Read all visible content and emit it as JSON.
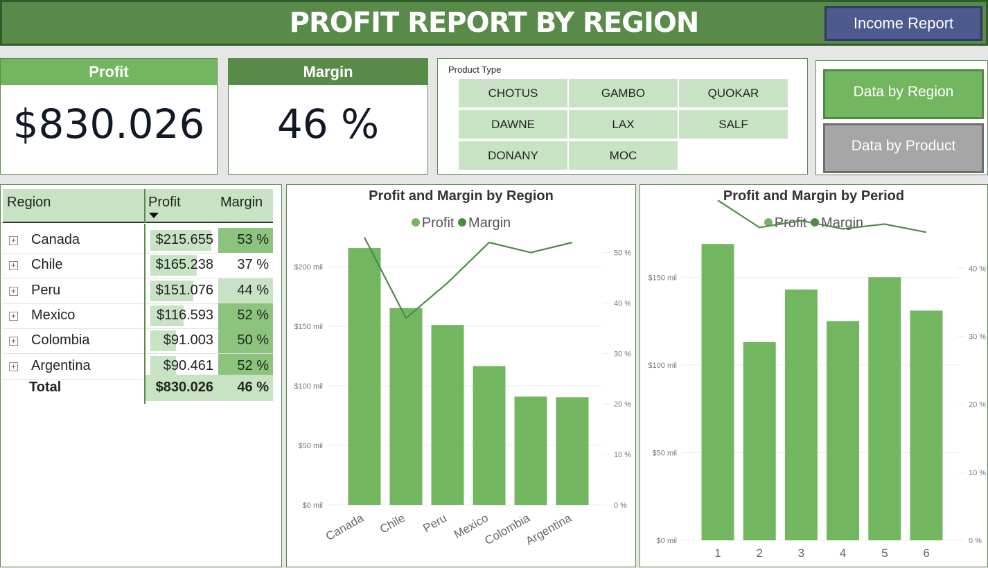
{
  "header": {
    "title": "PROFIT REPORT BY REGION",
    "income_button": "Income Report"
  },
  "colors": {
    "header_green": "#5a8a4a",
    "bar_green": "#73b660",
    "line_green": "#4f8a45",
    "light_green": "#c8e2c4",
    "dark_green": "#5a8a4a",
    "button_blue": "#4d5a8e",
    "button_gray": "#a6a6a6"
  },
  "cards": {
    "profit": {
      "label": "Profit",
      "value": "$830.026"
    },
    "margin": {
      "label": "Margin",
      "value": "46 %"
    }
  },
  "slicer": {
    "title": "Product Type",
    "options": [
      "CHOTUS",
      "GAMBO",
      "QUOKAR",
      "DAWNE",
      "LAX",
      "SALF",
      "DONANY",
      "MOC"
    ]
  },
  "nav": {
    "by_region": "Data by Region",
    "by_product": "Data by Product"
  },
  "table": {
    "headers": {
      "region": "Region",
      "profit": "Profit",
      "margin": "Margin"
    },
    "rows": [
      {
        "region": "Canada",
        "profit": "$215.655",
        "margin": "53 %",
        "profit_num": 215.655,
        "margin_num": 53
      },
      {
        "region": "Chile",
        "profit": "$165.238",
        "margin": "37 %",
        "profit_num": 165.238,
        "margin_num": 37
      },
      {
        "region": "Peru",
        "profit": "$151.076",
        "margin": "44 %",
        "profit_num": 151.076,
        "margin_num": 44
      },
      {
        "region": "Mexico",
        "profit": "$116.593",
        "margin": "52 %",
        "profit_num": 116.593,
        "margin_num": 52
      },
      {
        "region": "Colombia",
        "profit": "$91.003",
        "margin": "50 %",
        "profit_num": 91.003,
        "margin_num": 50
      },
      {
        "region": "Argentina",
        "profit": "$90.461",
        "margin": "52 %",
        "profit_num": 90.461,
        "margin_num": 52
      }
    ],
    "total": {
      "label": "Total",
      "profit": "$830.026",
      "margin": "46 %"
    }
  },
  "chart_data": [
    {
      "type": "bar",
      "title": "Profit and Margin by Region",
      "legend": [
        "Profit",
        "Margin"
      ],
      "legend_position": "top-center",
      "categories": [
        "Canada",
        "Chile",
        "Peru",
        "Mexico",
        "Colombia",
        "Argentina"
      ],
      "series": [
        {
          "name": "Profit",
          "type": "bar",
          "axis": "left",
          "values": [
            215.655,
            165.238,
            151.076,
            116.593,
            91.003,
            90.461
          ]
        },
        {
          "name": "Margin",
          "type": "line",
          "axis": "right",
          "values": [
            53,
            37,
            44,
            52,
            50,
            52
          ]
        }
      ],
      "y_left": {
        "ylim": [
          0,
          200
        ],
        "ticks": [
          0,
          50,
          100,
          150,
          200
        ],
        "tick_labels": [
          "$0 mil",
          "$50 mil",
          "$100 mil",
          "$150 mil",
          "$200 mil"
        ],
        "max": 250
      },
      "y_right": {
        "ylim": [
          0,
          50
        ],
        "ticks": [
          0,
          10,
          20,
          30,
          40,
          50
        ],
        "tick_labels": [
          "0 %",
          "10 %",
          "20 %",
          "30 %",
          "40 %",
          "50 %"
        ],
        "max": 59
      },
      "grid": true
    },
    {
      "type": "bar",
      "title": "Profit and Margin by Period",
      "legend": [
        "Profit",
        "Margin"
      ],
      "legend_position": "top-center",
      "categories": [
        "1",
        "2",
        "3",
        "4",
        "5",
        "6"
      ],
      "series": [
        {
          "name": "Profit",
          "type": "bar",
          "axis": "left",
          "values": [
            169,
            113,
            143,
            125,
            150,
            131
          ]
        },
        {
          "name": "Margin",
          "type": "line",
          "axis": "right",
          "values": [
            50,
            46,
            47,
            45.8,
            46.5,
            45.3
          ]
        }
      ],
      "y_left": {
        "ylim": [
          0,
          150
        ],
        "ticks": [
          0,
          50,
          100,
          150
        ],
        "tick_labels": [
          "$0 mil",
          "$50 mil",
          "$100 mil",
          "$150 mil"
        ],
        "max": 190
      },
      "y_right": {
        "ylim": [
          0,
          40
        ],
        "ticks": [
          0,
          10,
          20,
          30,
          40
        ],
        "tick_labels": [
          "0 %",
          "10 %",
          "20 %",
          "30 %",
          "40 %"
        ],
        "max": 49
      },
      "grid": true
    }
  ]
}
